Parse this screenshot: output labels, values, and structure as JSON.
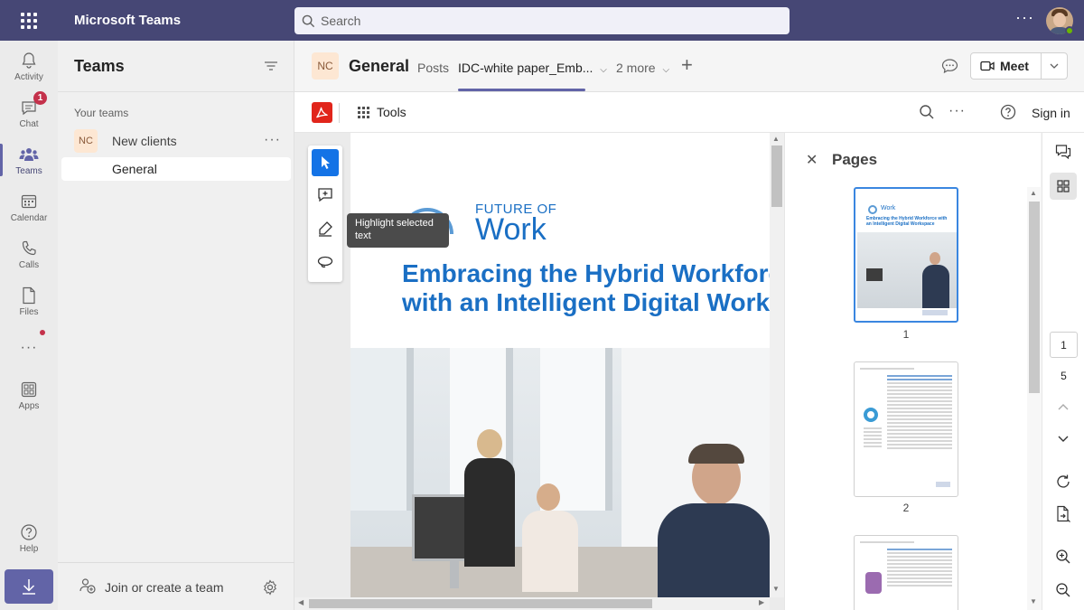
{
  "titlebar": {
    "app_name": "Microsoft Teams",
    "search_placeholder": "Search",
    "more_label": "···"
  },
  "rail": {
    "items": [
      {
        "label": "Activity",
        "icon": "bell-icon"
      },
      {
        "label": "Chat",
        "icon": "chat-icon",
        "badge": "1"
      },
      {
        "label": "Teams",
        "icon": "teams-icon"
      },
      {
        "label": "Calendar",
        "icon": "calendar-icon"
      },
      {
        "label": "Calls",
        "icon": "phone-icon"
      },
      {
        "label": "Files",
        "icon": "file-icon"
      },
      {
        "label": "···",
        "icon": "more-icon"
      },
      {
        "label": "Apps",
        "icon": "apps-icon"
      },
      {
        "label": "Help",
        "icon": "help-icon"
      }
    ],
    "active": "Teams"
  },
  "teams_panel": {
    "title": "Teams",
    "section_label": "Your teams",
    "team": {
      "initials": "NC",
      "name": "New clients",
      "more": "···"
    },
    "channel": "General",
    "join_label": "Join or create a team"
  },
  "channel_header": {
    "initials": "NC",
    "name": "General",
    "tabs": [
      {
        "label": "Posts",
        "active": false
      },
      {
        "label": "IDC-white paper_Emb...",
        "active": true
      },
      {
        "label": "2 more",
        "active": false
      }
    ],
    "meet_label": "Meet"
  },
  "acrobat": {
    "tools_label": "Tools",
    "more_label": "···",
    "sign_in": "Sign in",
    "tooltip": "Highlight selected text"
  },
  "document": {
    "brand_top": "FUTURE OF",
    "brand_main": "Work",
    "headline_1": "Embracing the Hybrid Workforce",
    "headline_2": "with an Intelligent Digital Worksp"
  },
  "pages_panel": {
    "title": "Pages",
    "thumb1": {
      "brand": "Work",
      "title": "Embracing the Hybrid Workforce with an Intelligent Digital Workspace"
    },
    "page_labels": [
      "1",
      "2"
    ]
  },
  "right_rail": {
    "current_page": "1",
    "total_pages": "5"
  },
  "colors": {
    "titlebar": "#464775",
    "accent": "#6264a7",
    "doc_blue": "#1a6fc4",
    "acrobat_red": "#e1251b",
    "badge_red": "#c4314b"
  }
}
